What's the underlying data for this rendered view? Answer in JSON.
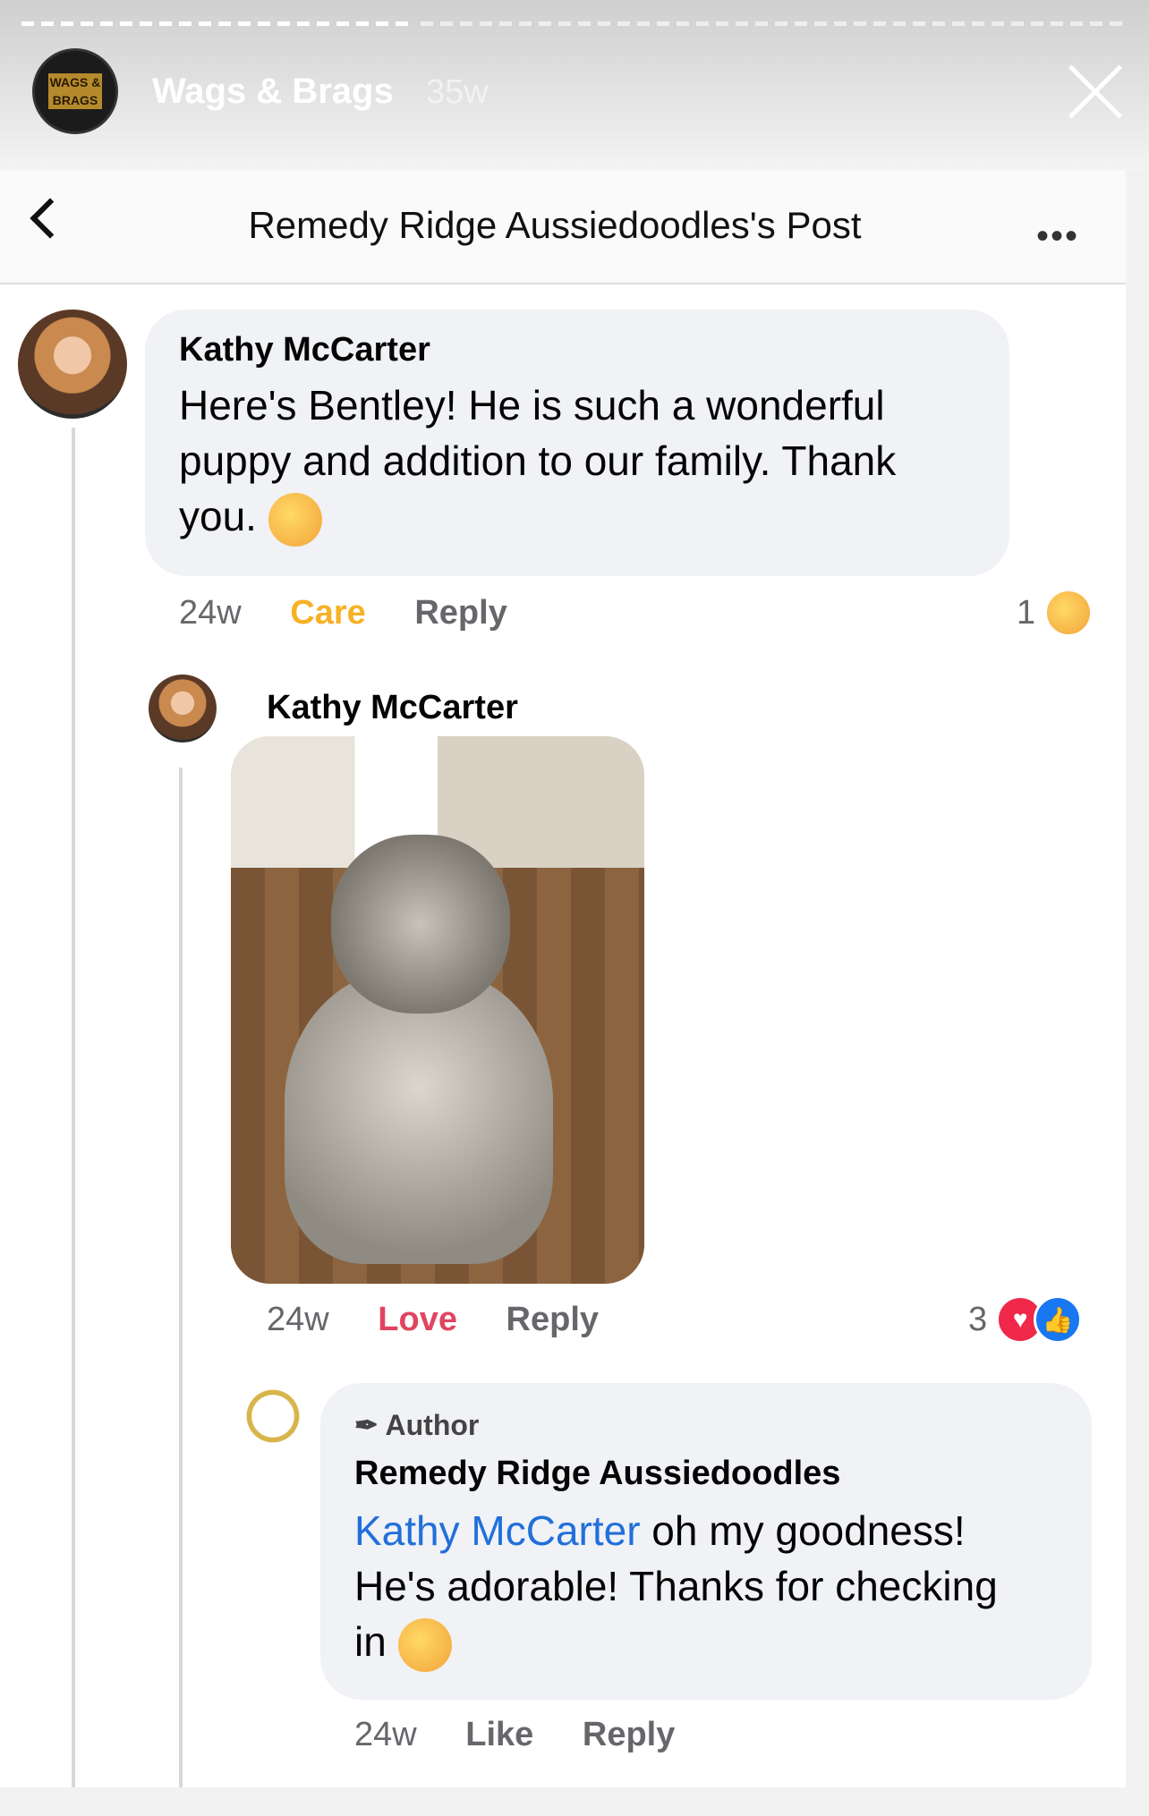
{
  "story": {
    "avatar_label": "WAGS & BRAGS",
    "name": "Wags & Brags",
    "time": "35w"
  },
  "header": {
    "title": "Remedy Ridge Aussiedoodles's Post",
    "more": "•••"
  },
  "comment1": {
    "author": "Kathy McCarter",
    "line1": "Here's Bentley!  He is such a wonderful",
    "line2": "puppy and addition to our family.  Thank",
    "line3": "you.",
    "time": "24w",
    "reaction_action": "Care",
    "reply": "Reply",
    "reaction_count": "1",
    "reaction_icon": "care-emoji-icon"
  },
  "comment2": {
    "author": "Kathy McCarter",
    "photo_icon": "dog-photo",
    "time": "24w",
    "reaction_action": "Love",
    "reply": "Reply",
    "reaction_count": "3",
    "reaction_icons": [
      "love-icon",
      "like-icon"
    ]
  },
  "reply1": {
    "badge": "Author",
    "author": "Remedy Ridge Aussiedoodles",
    "mention": "Kathy McCarter",
    "line1_rest": " oh my goodness!",
    "line2": "He's adorable! Thanks for checking",
    "line3": "in",
    "time": "24w",
    "like": "Like",
    "reply": "Reply"
  },
  "colors": {
    "care": "#f7b125",
    "love": "#e04560",
    "mention": "#216fdb",
    "like": "#1877f2"
  }
}
